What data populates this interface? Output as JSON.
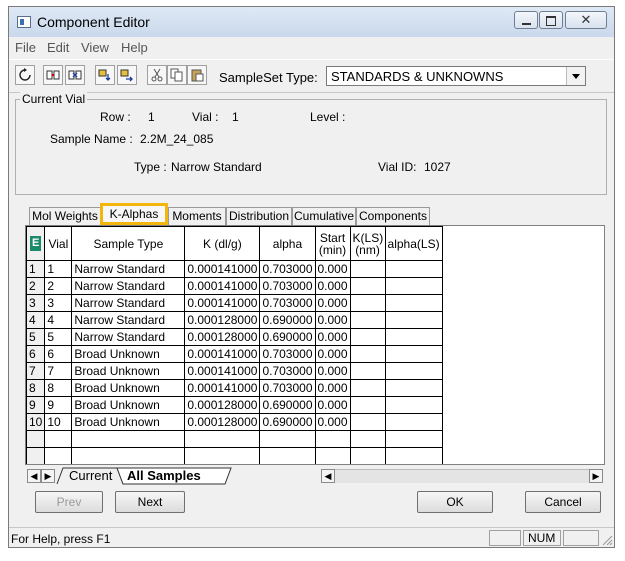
{
  "window": {
    "title": "Component Editor"
  },
  "menu": [
    "File",
    "Edit",
    "View",
    "Help"
  ],
  "toolbar": {
    "sample_set_type_label": "SampleSet Type:",
    "sample_set_type_value": "STANDARDS & UNKNOWNS"
  },
  "current_vial": {
    "legend": "Current Vial",
    "row_label": "Row :",
    "row_value": "1",
    "vial_label": "Vial :",
    "vial_value": "1",
    "level_label": "Level :",
    "sample_name_label": "Sample Name :",
    "sample_name_value": "2.2M_24_085",
    "type_label": "Type :",
    "type_value": "Narrow Standard",
    "vial_id_label": "Vial ID:",
    "vial_id_value": "1027"
  },
  "tabs": [
    "Mol Weights",
    "K-Alphas",
    "Moments",
    "Distribution",
    "Cumulative",
    "Components"
  ],
  "active_tab": "K-Alphas",
  "table": {
    "corner_icon": "grid-icon",
    "columns": [
      "Vial",
      "Sample Type",
      "K (dl/g)",
      "alpha",
      "Start (min)",
      "K(LS) (nm)",
      "alpha(LS)"
    ],
    "rows": [
      [
        "1",
        "1",
        "Narrow Standard",
        "0.000141000",
        "0.703000",
        "0.000",
        "",
        ""
      ],
      [
        "2",
        "2",
        "Narrow Standard",
        "0.000141000",
        "0.703000",
        "0.000",
        "",
        ""
      ],
      [
        "3",
        "3",
        "Narrow Standard",
        "0.000141000",
        "0.703000",
        "0.000",
        "",
        ""
      ],
      [
        "4",
        "4",
        "Narrow Standard",
        "0.000128000",
        "0.690000",
        "0.000",
        "",
        ""
      ],
      [
        "5",
        "5",
        "Narrow Standard",
        "0.000128000",
        "0.690000",
        "0.000",
        "",
        ""
      ],
      [
        "6",
        "6",
        "Broad Unknown",
        "0.000141000",
        "0.703000",
        "0.000",
        "",
        ""
      ],
      [
        "7",
        "7",
        "Broad Unknown",
        "0.000141000",
        "0.703000",
        "0.000",
        "",
        ""
      ],
      [
        "8",
        "8",
        "Broad Unknown",
        "0.000141000",
        "0.703000",
        "0.000",
        "",
        ""
      ],
      [
        "9",
        "9",
        "Broad Unknown",
        "0.000128000",
        "0.690000",
        "0.000",
        "",
        ""
      ],
      [
        "10",
        "10",
        "Broad Unknown",
        "0.000128000",
        "0.690000",
        "0.000",
        "",
        ""
      ]
    ]
  },
  "sheet_tabs": {
    "current": "Current",
    "all_samples": "All Samples"
  },
  "buttons": {
    "prev": "Prev",
    "next": "Next",
    "ok": "OK",
    "cancel": "Cancel"
  },
  "status": {
    "help_text": "For Help, press F1",
    "num": "NUM"
  },
  "colors": {
    "tab_highlight": "#f2b60d",
    "title_bar": "#c9d8ec"
  }
}
